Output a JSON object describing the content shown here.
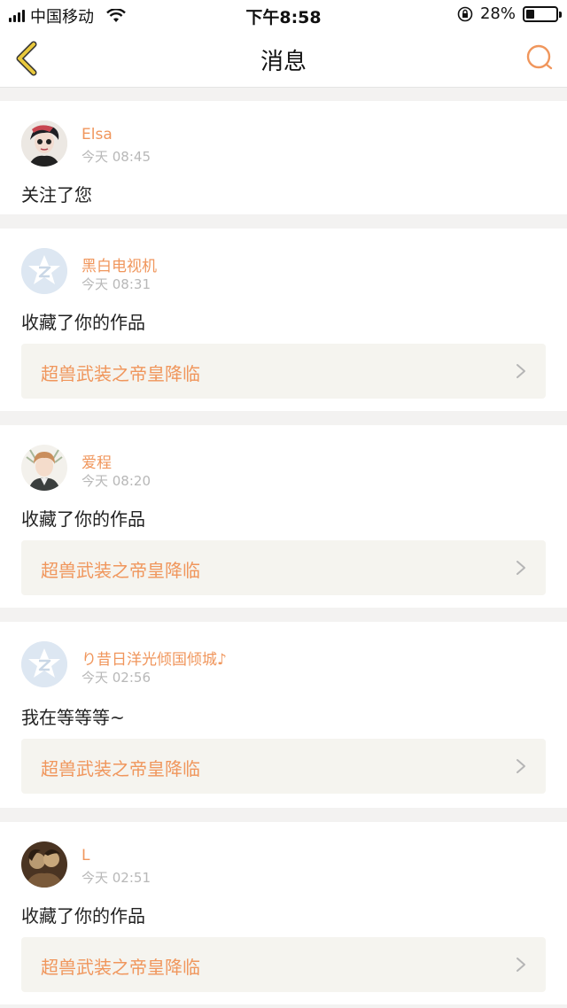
{
  "status_bar": {
    "carrier": "中国移动",
    "time": "下午8:58",
    "battery": "28%",
    "battery_level": 0.28
  },
  "nav": {
    "title": "消息"
  },
  "colors": {
    "accent": "#f0965c",
    "back_icon": "#e8c83c"
  },
  "messages": [
    {
      "name": "Elsa",
      "time": "今天 08:45",
      "text": "关注了您",
      "avatar": "photo-woman-icon"
    },
    {
      "name": "黑白电视机",
      "time": "今天 08:31",
      "text": "收藏了你的作品",
      "work": "超兽武装之帝皇降临",
      "avatar": "default-avatar-icon"
    },
    {
      "name": "爱程",
      "time": "今天 08:20",
      "text": "收藏了你的作品",
      "work": "超兽武装之帝皇降临",
      "avatar": "anime-boy-icon"
    },
    {
      "name": "り昔日洋光倾国倾城♪",
      "time": "今天 02:56",
      "text": "我在等等等~",
      "work": "超兽武装之帝皇降临",
      "avatar": "default-avatar-icon"
    },
    {
      "name": "L",
      "time": "今天 02:51",
      "text": "收藏了你的作品",
      "work": "超兽武装之帝皇降临",
      "avatar": "photo-couple-icon"
    }
  ]
}
